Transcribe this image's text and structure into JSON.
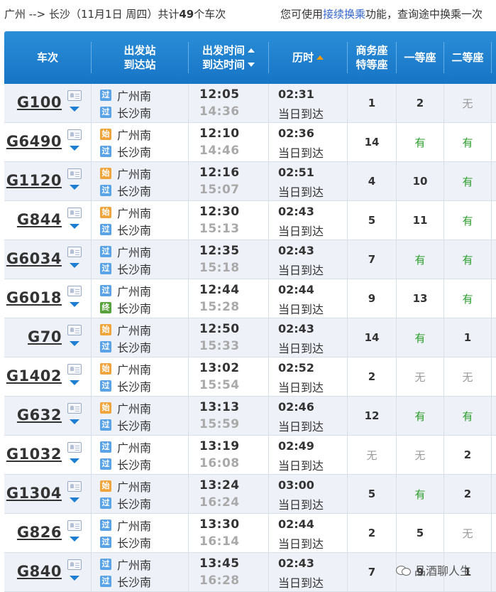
{
  "summary": {
    "route": "广州 --> 长沙",
    "date": "（11月1日  周四）",
    "count_prefix": "共计",
    "count": "49",
    "count_suffix": "个车次",
    "tip_prefix": "您可使用",
    "tip_link": "接续换乘",
    "tip_suffix": "功能，查询途中换乘一次"
  },
  "header": {
    "train": "车次",
    "station_from": "出发站",
    "station_to": "到达站",
    "dep_time": "出发时间",
    "arr_time": "到达时间",
    "duration": "历时",
    "business_1": "商务座",
    "business_2": "特等座",
    "first": "一等座",
    "second": "二等座"
  },
  "colors": {
    "header_bg": "#1e80d0",
    "available": "#2a9d2a",
    "none": "#9a9a9a",
    "arrival_time": "#a9a9a9"
  },
  "icons": {
    "card": "train-info-card-icon",
    "dropdown": "chevron-down-icon"
  },
  "rows": [
    {
      "train": "G100",
      "from_badge": "过",
      "from": "广州南",
      "to_badge": "过",
      "to": "长沙南",
      "dep": "12:05",
      "arr": "14:36",
      "dur": "02:31",
      "day": "当日到达",
      "biz": "1",
      "first": "2",
      "second": "无"
    },
    {
      "train": "G6490",
      "from_badge": "始",
      "from": "广州南",
      "to_badge": "过",
      "to": "长沙南",
      "dep": "12:10",
      "arr": "14:46",
      "dur": "02:36",
      "day": "当日到达",
      "biz": "14",
      "first": "有",
      "second": "有"
    },
    {
      "train": "G1120",
      "from_badge": "始",
      "from": "广州南",
      "to_badge": "过",
      "to": "长沙南",
      "dep": "12:16",
      "arr": "15:07",
      "dur": "02:51",
      "day": "当日到达",
      "biz": "4",
      "first": "10",
      "second": "有"
    },
    {
      "train": "G844",
      "from_badge": "始",
      "from": "广州南",
      "to_badge": "过",
      "to": "长沙南",
      "dep": "12:30",
      "arr": "15:13",
      "dur": "02:43",
      "day": "当日到达",
      "biz": "5",
      "first": "11",
      "second": "有"
    },
    {
      "train": "G6034",
      "from_badge": "过",
      "from": "广州南",
      "to_badge": "过",
      "to": "长沙南",
      "dep": "12:35",
      "arr": "15:18",
      "dur": "02:43",
      "day": "当日到达",
      "biz": "7",
      "first": "有",
      "second": "有"
    },
    {
      "train": "G6018",
      "from_badge": "过",
      "from": "广州南",
      "to_badge": "终",
      "to": "长沙南",
      "dep": "12:44",
      "arr": "15:28",
      "dur": "02:44",
      "day": "当日到达",
      "biz": "9",
      "first": "13",
      "second": "有"
    },
    {
      "train": "G70",
      "from_badge": "始",
      "from": "广州南",
      "to_badge": "过",
      "to": "长沙南",
      "dep": "12:50",
      "arr": "15:33",
      "dur": "02:43",
      "day": "当日到达",
      "biz": "14",
      "first": "有",
      "second": "1"
    },
    {
      "train": "G1402",
      "from_badge": "始",
      "from": "广州南",
      "to_badge": "过",
      "to": "长沙南",
      "dep": "13:02",
      "arr": "15:54",
      "dur": "02:52",
      "day": "当日到达",
      "biz": "2",
      "first": "无",
      "second": "无"
    },
    {
      "train": "G632",
      "from_badge": "始",
      "from": "广州南",
      "to_badge": "过",
      "to": "长沙南",
      "dep": "13:13",
      "arr": "15:59",
      "dur": "02:46",
      "day": "当日到达",
      "biz": "12",
      "first": "有",
      "second": "有"
    },
    {
      "train": "G1032",
      "from_badge": "过",
      "from": "广州南",
      "to_badge": "过",
      "to": "长沙南",
      "dep": "13:19",
      "arr": "16:08",
      "dur": "02:49",
      "day": "当日到达",
      "biz": "无",
      "first": "无",
      "second": "2"
    },
    {
      "train": "G1304",
      "from_badge": "始",
      "from": "广州南",
      "to_badge": "过",
      "to": "长沙南",
      "dep": "13:24",
      "arr": "16:24",
      "dur": "03:00",
      "day": "当日到达",
      "biz": "5",
      "first": "有",
      "second": "2"
    },
    {
      "train": "G826",
      "from_badge": "过",
      "from": "广州南",
      "to_badge": "过",
      "to": "长沙南",
      "dep": "13:30",
      "arr": "16:14",
      "dur": "02:44",
      "day": "当日到达",
      "biz": "2",
      "first": "5",
      "second": "无"
    },
    {
      "train": "G840",
      "from_badge": "过",
      "from": "广州南",
      "to_badge": "过",
      "to": "长沙南",
      "dep": "13:45",
      "arr": "16:28",
      "dur": "02:43",
      "day": "当日到达",
      "biz": "7",
      "first": "9",
      "second": "1"
    }
  ],
  "watermark": "品酒聊人生"
}
